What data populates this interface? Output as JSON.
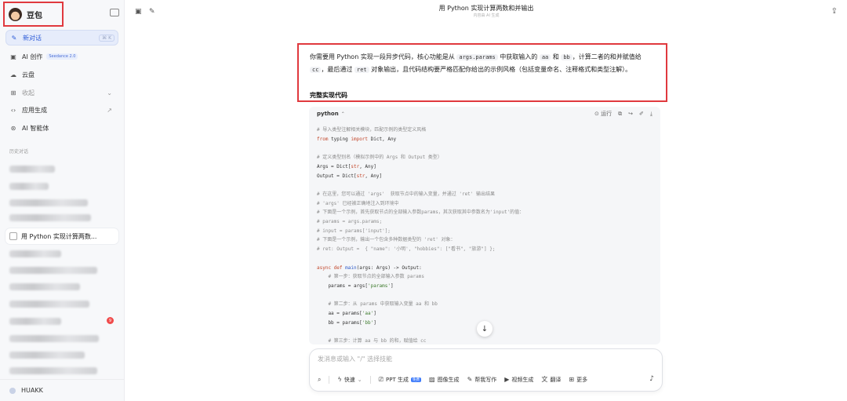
{
  "sidebar": {
    "brand_name": "豆包",
    "nav": [
      {
        "label": "新对话",
        "icon": "new-chat-icon",
        "glyph": "✎",
        "shortcut": "⌘ K"
      },
      {
        "label": "AI 创作",
        "icon": "image-create-icon",
        "glyph": "▣",
        "badge": "Seedance 2.0"
      },
      {
        "label": "云盘",
        "icon": "cloud-drive-icon",
        "glyph": "☁"
      },
      {
        "label": "收起",
        "icon": "grid-icon",
        "glyph": "⊞"
      },
      {
        "label": "应用生成",
        "icon": "code-icon",
        "glyph": "‹›"
      },
      {
        "label": "AI 智能体",
        "icon": "agent-icon",
        "glyph": "⊛"
      }
    ],
    "history_label": "历史对话",
    "active_history": "用 Python 实现计算两数...",
    "unread_badge": "9",
    "user_name": "HUAKK"
  },
  "topbar": {
    "title": "用 Python 实现计算两数和并输出",
    "subtitle": "内容由 AI 生成"
  },
  "message": {
    "parts": [
      {
        "t": "你需要用 Python 实现一段异步代码，核心功能是从 ",
        "code": false
      },
      {
        "t": "args.params",
        "code": true
      },
      {
        "t": " 中获取输入的 ",
        "code": false
      },
      {
        "t": "aa",
        "code": true
      },
      {
        "t": " 和 ",
        "code": false
      },
      {
        "t": "bb",
        "code": true
      },
      {
        "t": "，计算二者的和并赋值给 ",
        "code": false
      },
      {
        "t": "cc",
        "code": true
      },
      {
        "t": "，最后通过 ",
        "code": false
      },
      {
        "t": "ret",
        "code": true
      },
      {
        "t": " 对象输出，且代码结构要严格匹配你给出的示例风格（包括变量命名、注释格式和类型注解）。",
        "code": false
      }
    ],
    "section_title": "完整实现代码"
  },
  "code_block": {
    "language": "python",
    "run_label": "运行",
    "lines": [
      [
        {
          "c": "com",
          "t": "# 导入类型注解相关模块，匹配示例的类型定义风格"
        }
      ],
      [
        {
          "c": "kw",
          "t": "from"
        },
        {
          "c": "",
          "t": " typing "
        },
        {
          "c": "kw",
          "t": "import"
        },
        {
          "c": "",
          "t": " Dict, Any"
        }
      ],
      [],
      [
        {
          "c": "com",
          "t": "# 定义类型别名（模拟示例中的 Args 和 Output 类型）"
        }
      ],
      [
        {
          "c": "",
          "t": "Args = Dict["
        },
        {
          "c": "kw",
          "t": "str"
        },
        {
          "c": "",
          "t": ", Any]"
        }
      ],
      [
        {
          "c": "",
          "t": "Output = Dict["
        },
        {
          "c": "kw",
          "t": "str"
        },
        {
          "c": "",
          "t": ", Any]"
        }
      ],
      [],
      [
        {
          "c": "com",
          "t": "# 在这里，您可以通过 'args'  获取节点中的输入变量，并通过 'ret' 输出结果"
        }
      ],
      [
        {
          "c": "com",
          "t": "# 'args' 已经被正确地注入到环境中"
        }
      ],
      [
        {
          "c": "com",
          "t": "# 下面是一个示例，首先获取节点的全部输入参数params，其次获取其中参数名为'input'的值："
        }
      ],
      [
        {
          "c": "com",
          "t": "# params = args.params;"
        }
      ],
      [
        {
          "c": "com",
          "t": "# input = params['input'];"
        }
      ],
      [
        {
          "c": "com",
          "t": "# 下面是一个示例，输出一个包含多种数据类型的 'ret' 对象："
        }
      ],
      [
        {
          "c": "com",
          "t": "# ret: Output =  { \"name\": '小明', \"hobbies\": [\"看书\", \"旅游\"] };"
        }
      ],
      [],
      [
        {
          "c": "kw",
          "t": "async def"
        },
        {
          "c": "",
          "t": " "
        },
        {
          "c": "fn",
          "t": "main"
        },
        {
          "c": "",
          "t": "(args: Args) -> Output:"
        }
      ],
      [
        {
          "c": "com",
          "t": "    # 第一步：获取节点的全部输入参数 params"
        }
      ],
      [
        {
          "c": "",
          "t": "    params = args["
        },
        {
          "c": "str",
          "t": "'params'"
        },
        {
          "c": "",
          "t": "]"
        }
      ],
      [],
      [
        {
          "c": "com",
          "t": "    # 第二步：从 params 中获取输入变量 aa 和 bb"
        }
      ],
      [
        {
          "c": "",
          "t": "    aa = params["
        },
        {
          "c": "str",
          "t": "'aa'"
        },
        {
          "c": "",
          "t": "]"
        }
      ],
      [
        {
          "c": "",
          "t": "    bb = params["
        },
        {
          "c": "str",
          "t": "'bb'"
        },
        {
          "c": "",
          "t": "]"
        }
      ],
      [],
      [
        {
          "c": "com",
          "t": "    # 第三步：计算 aa 与 bb 的和，赋值给 cc"
        }
      ]
    ]
  },
  "input": {
    "placeholder": "发消息或输入 \"/\" 选择技能",
    "tools": [
      {
        "label": "快速",
        "icon": "bolt-icon",
        "glyph": "ϟ",
        "chev": true
      },
      {
        "label": "PPT 生成",
        "icon": "ppt-icon",
        "glyph": "⎚",
        "new": "免费"
      },
      {
        "label": "图像生成",
        "icon": "image-icon",
        "glyph": "▨"
      },
      {
        "label": "帮我写作",
        "icon": "write-icon",
        "glyph": "✎"
      },
      {
        "label": "视频生成",
        "icon": "video-icon",
        "glyph": "▶"
      },
      {
        "label": "翻译",
        "icon": "translate-icon",
        "glyph": "文"
      },
      {
        "label": "更多",
        "icon": "more-icon",
        "glyph": "⊞"
      }
    ]
  },
  "colors": {
    "accent": "#2c5bd7",
    "highlight_border": "#e0393e",
    "badge_red": "#f04b4b"
  }
}
